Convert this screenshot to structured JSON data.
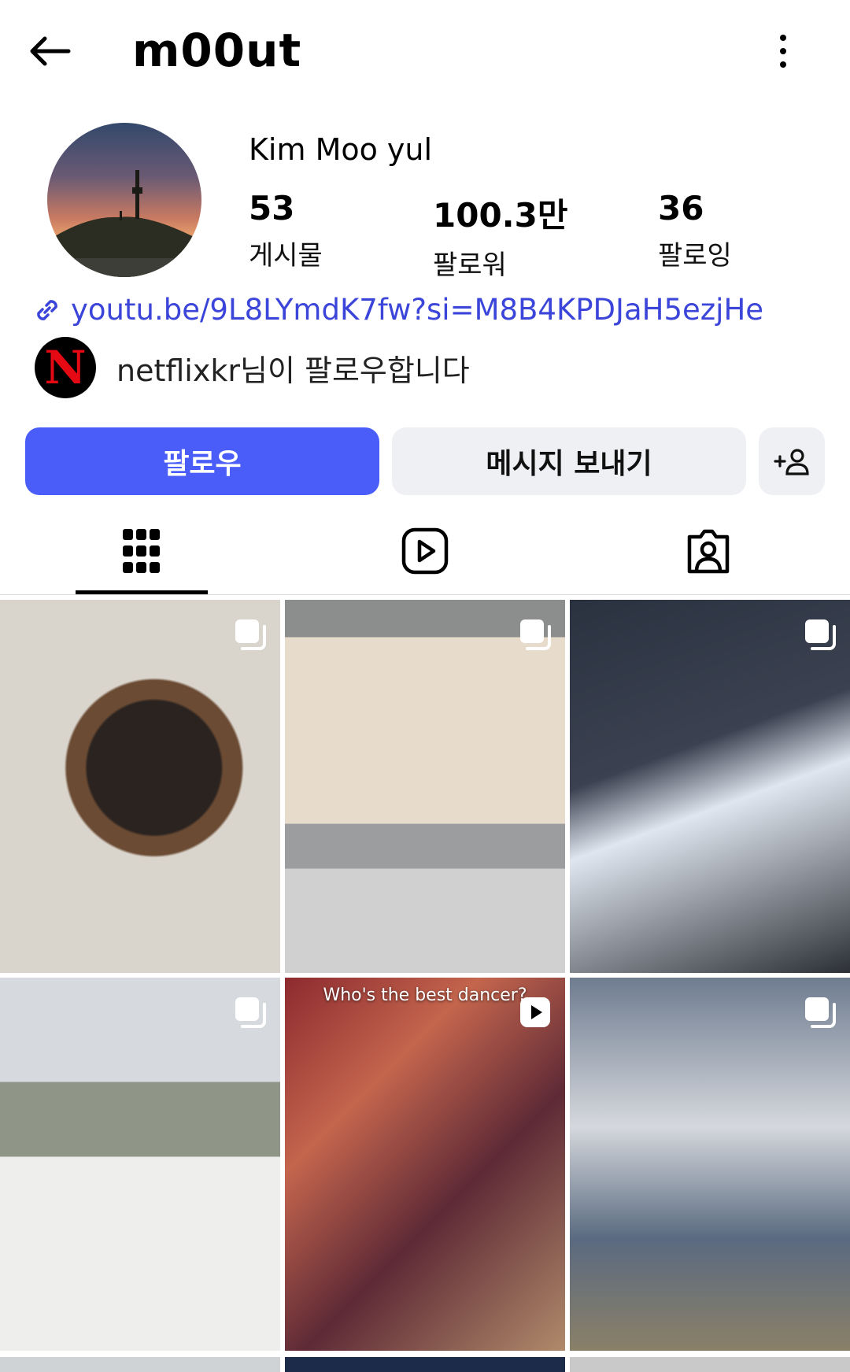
{
  "header": {
    "username": "m00ut"
  },
  "profile": {
    "full_name": "Kim Moo yul",
    "stats": {
      "posts": {
        "value": "53",
        "label": "게시물"
      },
      "followers": {
        "value": "100.3만",
        "label": "팔로워"
      },
      "following": {
        "value": "36",
        "label": "팔로잉"
      }
    },
    "link": "youtu.be/9L8LYmdK7fw?si=M8B4KPDJaH5ezjHe",
    "followed_by": {
      "name": "netflixkr",
      "suffix": "님이 팔로우합니다",
      "avatar_letter": "N"
    }
  },
  "actions": {
    "follow_label": "팔로우",
    "message_label": "메시지 보내기"
  },
  "tabs": {
    "active": "grid",
    "items": [
      "grid-icon",
      "reels-icon",
      "tagged-icon"
    ]
  },
  "grid": {
    "posts": [
      {
        "badge": "carousel-icon",
        "caption": ""
      },
      {
        "badge": "carousel-icon",
        "caption": ""
      },
      {
        "badge": "carousel-icon",
        "caption": ""
      },
      {
        "badge": "carousel-icon",
        "caption": ""
      },
      {
        "badge": "reel-icon",
        "caption": "Who's the best dancer?"
      },
      {
        "badge": "carousel-icon",
        "caption": ""
      }
    ]
  },
  "colors": {
    "accent": "#4a5df9",
    "link": "#3b45d9",
    "secondary_button": "#eef0f4"
  }
}
